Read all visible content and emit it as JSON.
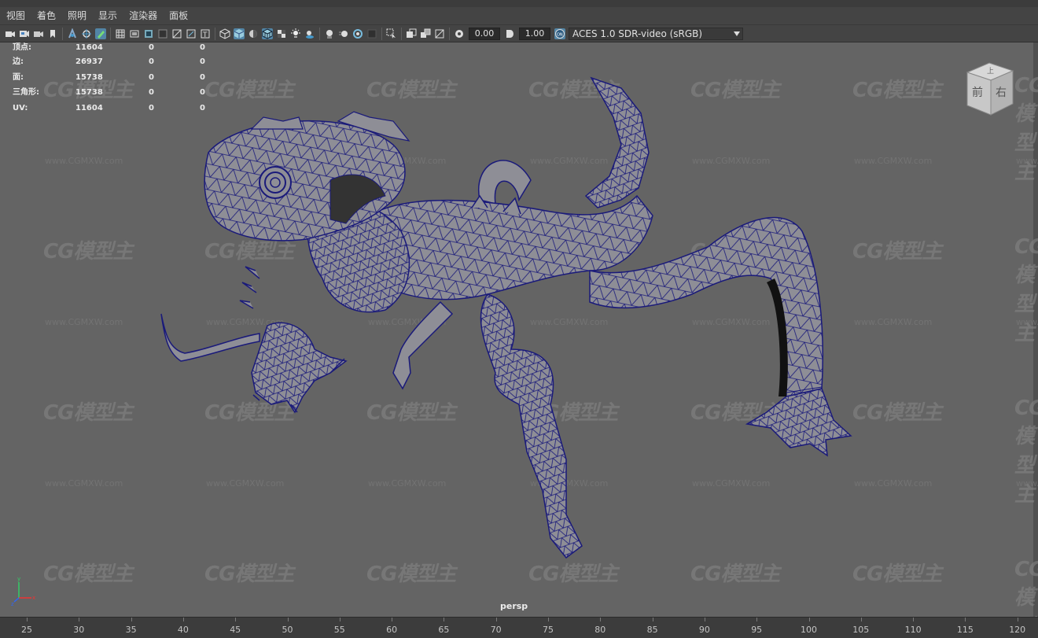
{
  "menu": [
    "视图",
    "着色",
    "照明",
    "显示",
    "渲染器",
    "面板"
  ],
  "toolbar": {
    "icons": [
      "camera-icon",
      "camera-attrs-icon",
      "bookmark-icon",
      "bookmark2-icon",
      "image-plane-icon",
      "2d-pan-icon",
      "grease-pencil-icon",
      "grid-icon",
      "film-gate-icon",
      "resolution-gate-icon",
      "gate-mask-icon",
      "field-chart-icon",
      "safe-action-icon",
      "safe-title-icon",
      "wireframe-icon",
      "smooth-shade-icon",
      "default-material-icon",
      "wireframe-on-shaded-icon",
      "textured-icon",
      "use-all-lights-icon",
      "shadows-icon",
      "screen-space-ao-icon",
      "motion-blur-icon",
      "multisample-icon",
      "depth-of-field-icon",
      "isolate-select-icon",
      "xray-icon",
      "xray-joints-icon",
      "backface-icon",
      "exposure-icon",
      "gamma-icon",
      "color-management-icon"
    ],
    "exposure_value": "0.00",
    "gamma_value": "1.00",
    "colorspace": "ACES 1.0 SDR-video (sRGB)"
  },
  "hud": [
    {
      "label": "顶点:",
      "v1": "11604",
      "v2": "0",
      "v3": "0"
    },
    {
      "label": "边:",
      "v1": "26937",
      "v2": "0",
      "v3": "0"
    },
    {
      "label": "面:",
      "v1": "15738",
      "v2": "0",
      "v3": "0"
    },
    {
      "label": "三角形:",
      "v1": "15738",
      "v2": "0",
      "v3": "0"
    },
    {
      "label": "UV:",
      "v1": "11604",
      "v2": "0",
      "v3": "0"
    }
  ],
  "watermark": {
    "logo": "CG模型主",
    "url": "www.CGMXW.com"
  },
  "viewcube": {
    "top": "上",
    "front": "前",
    "right": "右"
  },
  "camera": "persp",
  "axis": {
    "x": "x",
    "y": "y",
    "z": "z"
  },
  "timeline": {
    "ticks": [
      "25",
      "30",
      "35",
      "40",
      "45",
      "50",
      "55",
      "60",
      "65",
      "70",
      "75",
      "80",
      "85",
      "90",
      "95",
      "100",
      "105",
      "110",
      "115",
      "120"
    ]
  },
  "colors": {
    "wire": "#1a1a7a",
    "mesh": "#8e8e96",
    "viewport": "#646464",
    "accent": "#5285a6"
  }
}
